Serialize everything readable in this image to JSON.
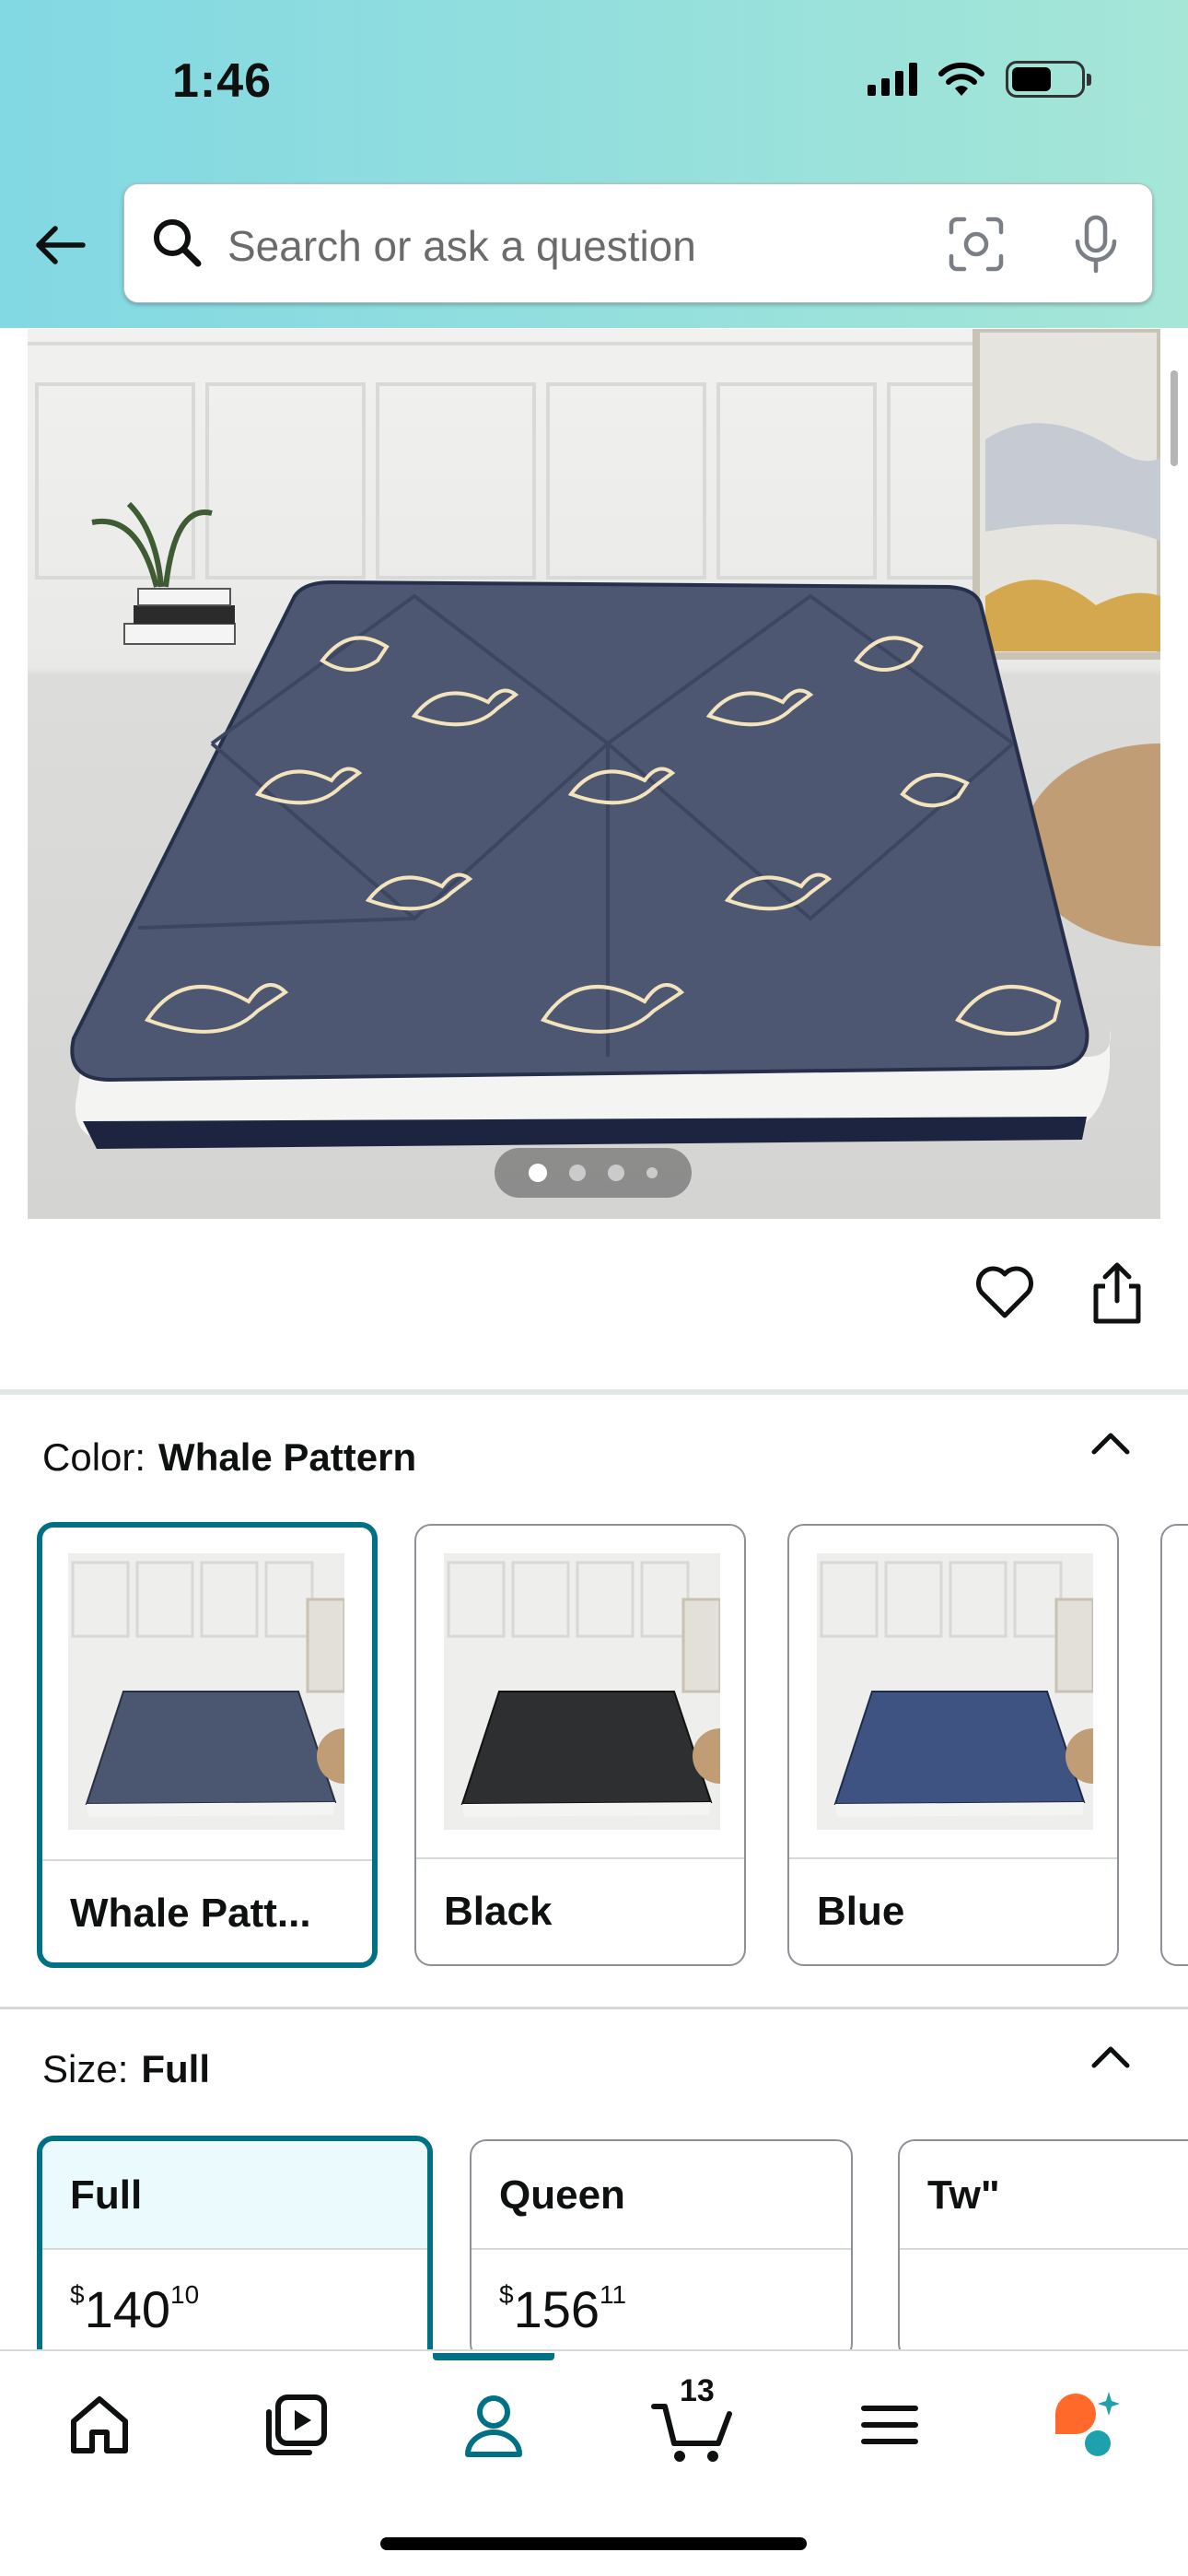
{
  "status_bar": {
    "time": "1:46"
  },
  "search": {
    "placeholder": "Search or ask a question"
  },
  "carousel": {
    "total": 4,
    "active": 1
  },
  "color": {
    "label": "Color:",
    "selected": "Whale Pattern",
    "options": [
      {
        "label": "Whale Patt...",
        "tone": "#4b5670"
      },
      {
        "label": "Black",
        "tone": "#2e2f31"
      },
      {
        "label": "Blue",
        "tone": "#3f5382"
      }
    ]
  },
  "size": {
    "label": "Size:",
    "selected": "Full",
    "options": [
      {
        "name": "Full",
        "price_dollar": "$",
        "price_whole": "140",
        "price_cents": "10"
      },
      {
        "name": "Queen",
        "price_dollar": "$",
        "price_whole": "156",
        "price_cents": "11"
      },
      {
        "name": "Tw\"",
        "price_dollar": "",
        "price_whole": "",
        "price_cents": ""
      }
    ]
  },
  "bottom_nav": {
    "items": [
      "home-icon",
      "video-icon",
      "account-icon",
      "cart-icon",
      "menu-icon",
      "assistant-icon"
    ],
    "cart_count": "13",
    "active": "account-icon"
  },
  "colors": {
    "accent": "#007185",
    "selected_bg": "#ebfbfd",
    "assistant_orange": "#ff6a2b",
    "assistant_teal": "#1fa1ad"
  }
}
